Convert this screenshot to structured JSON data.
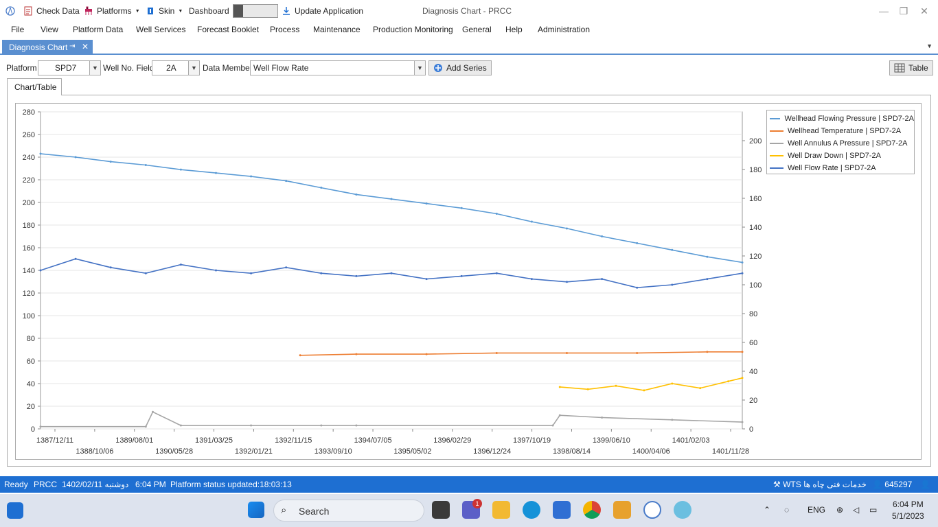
{
  "titlebar": {
    "check_data": "Check Data",
    "platforms": "Platforms",
    "skin": "Skin",
    "dashboard": "Dashboard",
    "update_app": "Update Application",
    "window_title": "Diagnosis Chart - PRCC"
  },
  "menu": [
    "File",
    "View",
    "Platform Data",
    "Well Services",
    "Forecast Booklet",
    "Process",
    "Maintenance",
    "Production Monitoring",
    "General",
    "Help",
    "Administration"
  ],
  "doc_tab": "Diagnosis Chart",
  "toolbar": {
    "platform_label": "Platform",
    "platform_value": "SPD7",
    "well_label": "Well No. Field",
    "well_value": "2A",
    "member_label": "Data Member",
    "member_value": "Well Flow Rate",
    "add_series": "Add Series",
    "table": "Table"
  },
  "chart_tab": "Chart/Table",
  "chart_data": {
    "type": "line",
    "y_left": {
      "min": 0,
      "max": 280,
      "ticks": [
        "0",
        "20",
        "40",
        "60",
        "80",
        "100",
        "120",
        "140",
        "160",
        "180",
        "200",
        "220",
        "240",
        "260",
        "280"
      ]
    },
    "y_right": {
      "min": 0,
      "max": 220,
      "ticks": [
        "0",
        "20",
        "40",
        "60",
        "80",
        "100",
        "120",
        "140",
        "160",
        "180",
        "200"
      ]
    },
    "x_ticks_top": [
      "1387/12/11",
      "1389/08/01",
      "1391/03/25",
      "1392/11/15",
      "1394/07/05",
      "1396/02/29",
      "1397/10/19",
      "1399/06/10",
      "1401/02/03"
    ],
    "x_ticks_bottom": [
      "1388/10/06",
      "1390/05/28",
      "1392/01/21",
      "1393/09/10",
      "1395/05/02",
      "1396/12/24",
      "1398/08/14",
      "1400/04/06",
      "1401/11/28"
    ],
    "legend_position": "top-right",
    "grid": true,
    "series": [
      {
        "name": "Wellhead Flowing Pressure | SPD7-2A",
        "color": "#5b9bd5",
        "axis": "left",
        "x": [
          0.0,
          0.05,
          0.1,
          0.15,
          0.2,
          0.25,
          0.3,
          0.35,
          0.4,
          0.45,
          0.5,
          0.55,
          0.6,
          0.65,
          0.7,
          0.75,
          0.8,
          0.85,
          0.9,
          0.95,
          1.0
        ],
        "values": [
          243,
          240,
          236,
          233,
          229,
          226,
          223,
          219,
          213,
          207,
          203,
          199,
          195,
          190,
          183,
          177,
          170,
          164,
          158,
          152,
          147
        ]
      },
      {
        "name": "Wellhead Temperature | SPD7-2A",
        "color": "#ed7d31",
        "axis": "left",
        "x": [
          0.37,
          0.45,
          0.55,
          0.65,
          0.75,
          0.85,
          0.95,
          1.0
        ],
        "values": [
          65,
          66,
          66,
          67,
          67,
          67,
          68,
          68
        ]
      },
      {
        "name": "Well Annulus A Pressure | SPD7-2A",
        "color": "#a5a5a5",
        "axis": "left",
        "x": [
          0.0,
          0.15,
          0.16,
          0.2,
          0.3,
          0.4,
          0.45,
          0.73,
          0.74,
          0.8,
          0.9,
          1.0
        ],
        "values": [
          2,
          2,
          15,
          3,
          3,
          3,
          3,
          3,
          12,
          10,
          8,
          6
        ]
      },
      {
        "name": "Well Draw Down | SPD7-2A",
        "color": "#ffc000",
        "axis": "left",
        "x": [
          0.74,
          0.78,
          0.82,
          0.86,
          0.9,
          0.94,
          0.98,
          1.0
        ],
        "values": [
          37,
          35,
          38,
          34,
          40,
          36,
          42,
          45
        ]
      },
      {
        "name": "Well Flow Rate | SPD7-2A",
        "color": "#4472c4",
        "axis": "right",
        "x": [
          0.0,
          0.05,
          0.1,
          0.15,
          0.2,
          0.25,
          0.3,
          0.35,
          0.4,
          0.45,
          0.5,
          0.55,
          0.6,
          0.65,
          0.7,
          0.75,
          0.8,
          0.85,
          0.9,
          0.95,
          1.0
        ],
        "values": [
          110,
          118,
          112,
          108,
          114,
          110,
          108,
          112,
          108,
          106,
          108,
          104,
          106,
          108,
          104,
          102,
          104,
          98,
          100,
          104,
          108
        ]
      }
    ]
  },
  "status": {
    "ready": "Ready",
    "app": "PRCC",
    "date": "1402/02/11 دوشنبه",
    "time": "6:04 PM",
    "platform_status": "Platform status updated:18:03:13",
    "service": "WTS خدمات فنی چاه ها",
    "user": "645297"
  },
  "taskbar": {
    "search": "Search",
    "lang": "ENG",
    "time": "6:04 PM",
    "date": "5/1/2023",
    "badge": "1"
  }
}
